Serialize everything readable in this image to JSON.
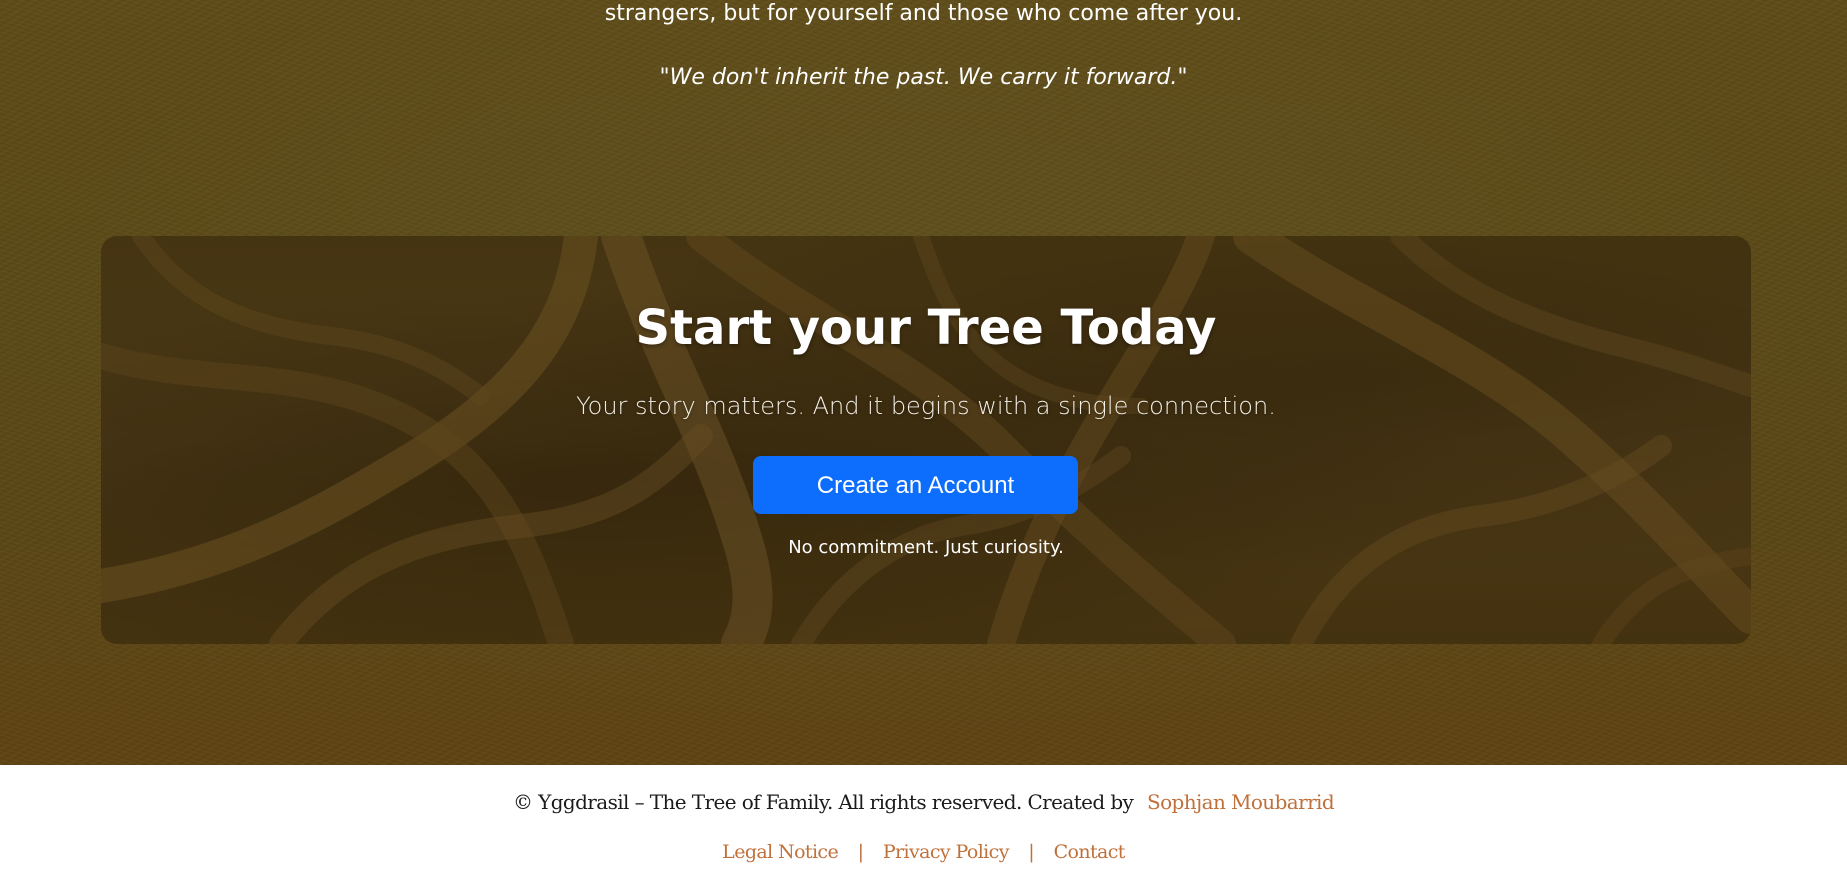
{
  "hero": {
    "intro_line": "strangers, but for yourself and those who come after you.",
    "quote": "\"We don't inherit the past. We carry it forward.\""
  },
  "cta": {
    "title": "Start your Tree Today",
    "subtitle": "Your story matters. And it begins with a single connection.",
    "button_label": "Create an Account",
    "note": "No commitment. Just curiosity."
  },
  "footer": {
    "copyright": "© Yggdrasil – The Tree of Family. All rights reserved. Created by",
    "author_link": "Sophjan Moubarrid",
    "links": [
      {
        "label": "Legal Notice"
      },
      {
        "label": "Privacy Policy"
      },
      {
        "label": "Contact"
      }
    ],
    "separator": "|"
  },
  "colors": {
    "hero_bg": "#5b4916",
    "button_bg": "#0d6efd",
    "link": "#c0703a"
  }
}
